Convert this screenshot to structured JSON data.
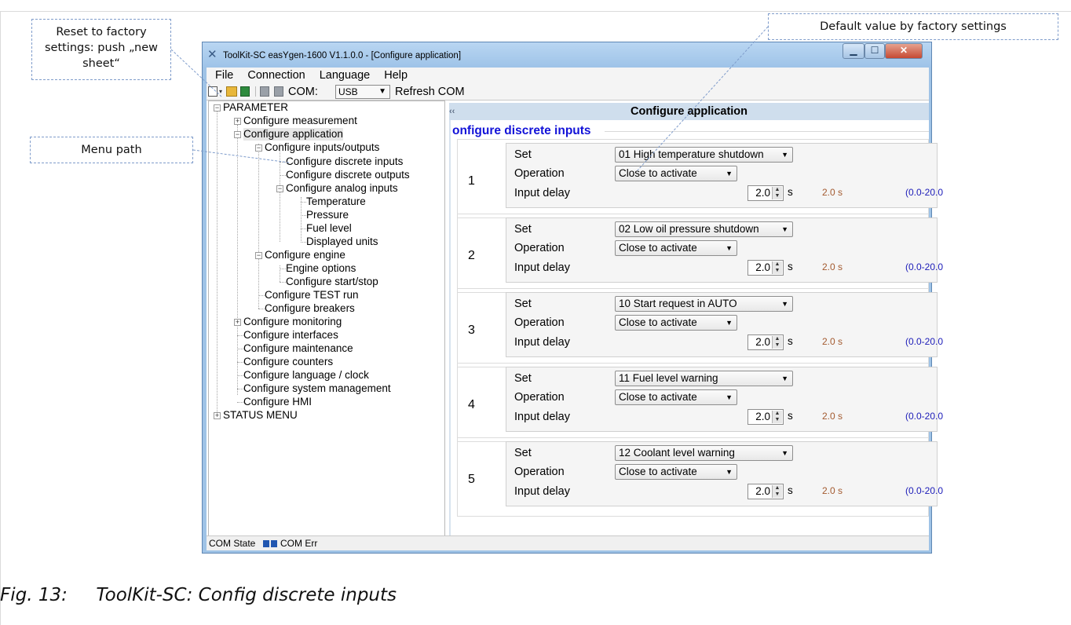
{
  "callouts": {
    "reset": "Reset to factory settings: push „new sheet“",
    "menu_path": "Menu path",
    "default_value": "Default value by factory settings"
  },
  "window": {
    "title": "ToolKit-SC easYgen-1600  V1.1.0.0 - [Configure application]",
    "controls": {
      "minimize": "minimize-icon",
      "maximize": "maximize-icon",
      "close": "close-icon"
    }
  },
  "menubar": [
    "File",
    "Connection",
    "Language",
    "Help"
  ],
  "toolbar": {
    "com_label": "COM:",
    "com_value": "USB",
    "refresh_label": "Refresh COM",
    "icons": [
      "new-sheet-icon",
      "dropdown-icon",
      "open-folder-icon",
      "save-icon",
      "read-icon",
      "write-icon"
    ]
  },
  "tree": {
    "parameter": "PARAMETER",
    "configure_measurement": "Configure measurement",
    "configure_application": "Configure application",
    "configure_io": "Configure inputs/outputs",
    "configure_discrete_inputs": "Configure discrete inputs",
    "configure_discrete_outputs": "Configure discrete outputs",
    "configure_analog_inputs": "Configure analog inputs",
    "temperature": "Temperature",
    "pressure": "Pressure",
    "fuel_level": "Fuel level",
    "displayed_units": "Displayed units",
    "configure_engine": "Configure engine",
    "engine_options": "Engine options",
    "configure_start_stop": "Configure start/stop",
    "configure_test_run": "Configure TEST run",
    "configure_breakers": "Configure breakers",
    "configure_monitoring": "Configure monitoring",
    "configure_interfaces": "Configure interfaces",
    "configure_maintenance": "Configure maintenance",
    "configure_counters": "Configure counters",
    "configure_language_clock": "Configure language / clock",
    "configure_system_management": "Configure system management",
    "configure_hmi": "Configure HMI",
    "status_menu": "STATUS MENU"
  },
  "status_bar": {
    "com_state": "COM State",
    "com_err": "COM Err"
  },
  "content": {
    "collapse_glyph": "‹‹",
    "header": "Configure application",
    "section_title": "onfigure discrete inputs",
    "field_labels": {
      "set": "Set",
      "operation": "Operation",
      "input_delay": "Input delay"
    },
    "inputs": [
      {
        "number": "1",
        "set": "01 High temperature shutdown",
        "operation": "Close to activate",
        "delay": "2.0",
        "unit": "s",
        "default": "2.0 s",
        "range": "(0.0-20.0"
      },
      {
        "number": "2",
        "set": "02 Low oil pressure shutdown",
        "operation": "Close to activate",
        "delay": "2.0",
        "unit": "s",
        "default": "2.0 s",
        "range": "(0.0-20.0"
      },
      {
        "number": "3",
        "set": "10 Start request in AUTO",
        "operation": "Close to activate",
        "delay": "2.0",
        "unit": "s",
        "default": "2.0 s",
        "range": "(0.0-20.0"
      },
      {
        "number": "4",
        "set": "11 Fuel level warning",
        "operation": "Close to activate",
        "delay": "2.0",
        "unit": "s",
        "default": "2.0 s",
        "range": "(0.0-20.0"
      },
      {
        "number": "5",
        "set": "12 Coolant level warning",
        "operation": "Close to activate",
        "delay": "2.0",
        "unit": "s",
        "default": "2.0 s",
        "range": "(0.0-20.0"
      }
    ]
  },
  "caption": {
    "number": "Fig. 13:",
    "text": "ToolKit-SC: Config discrete inputs"
  }
}
